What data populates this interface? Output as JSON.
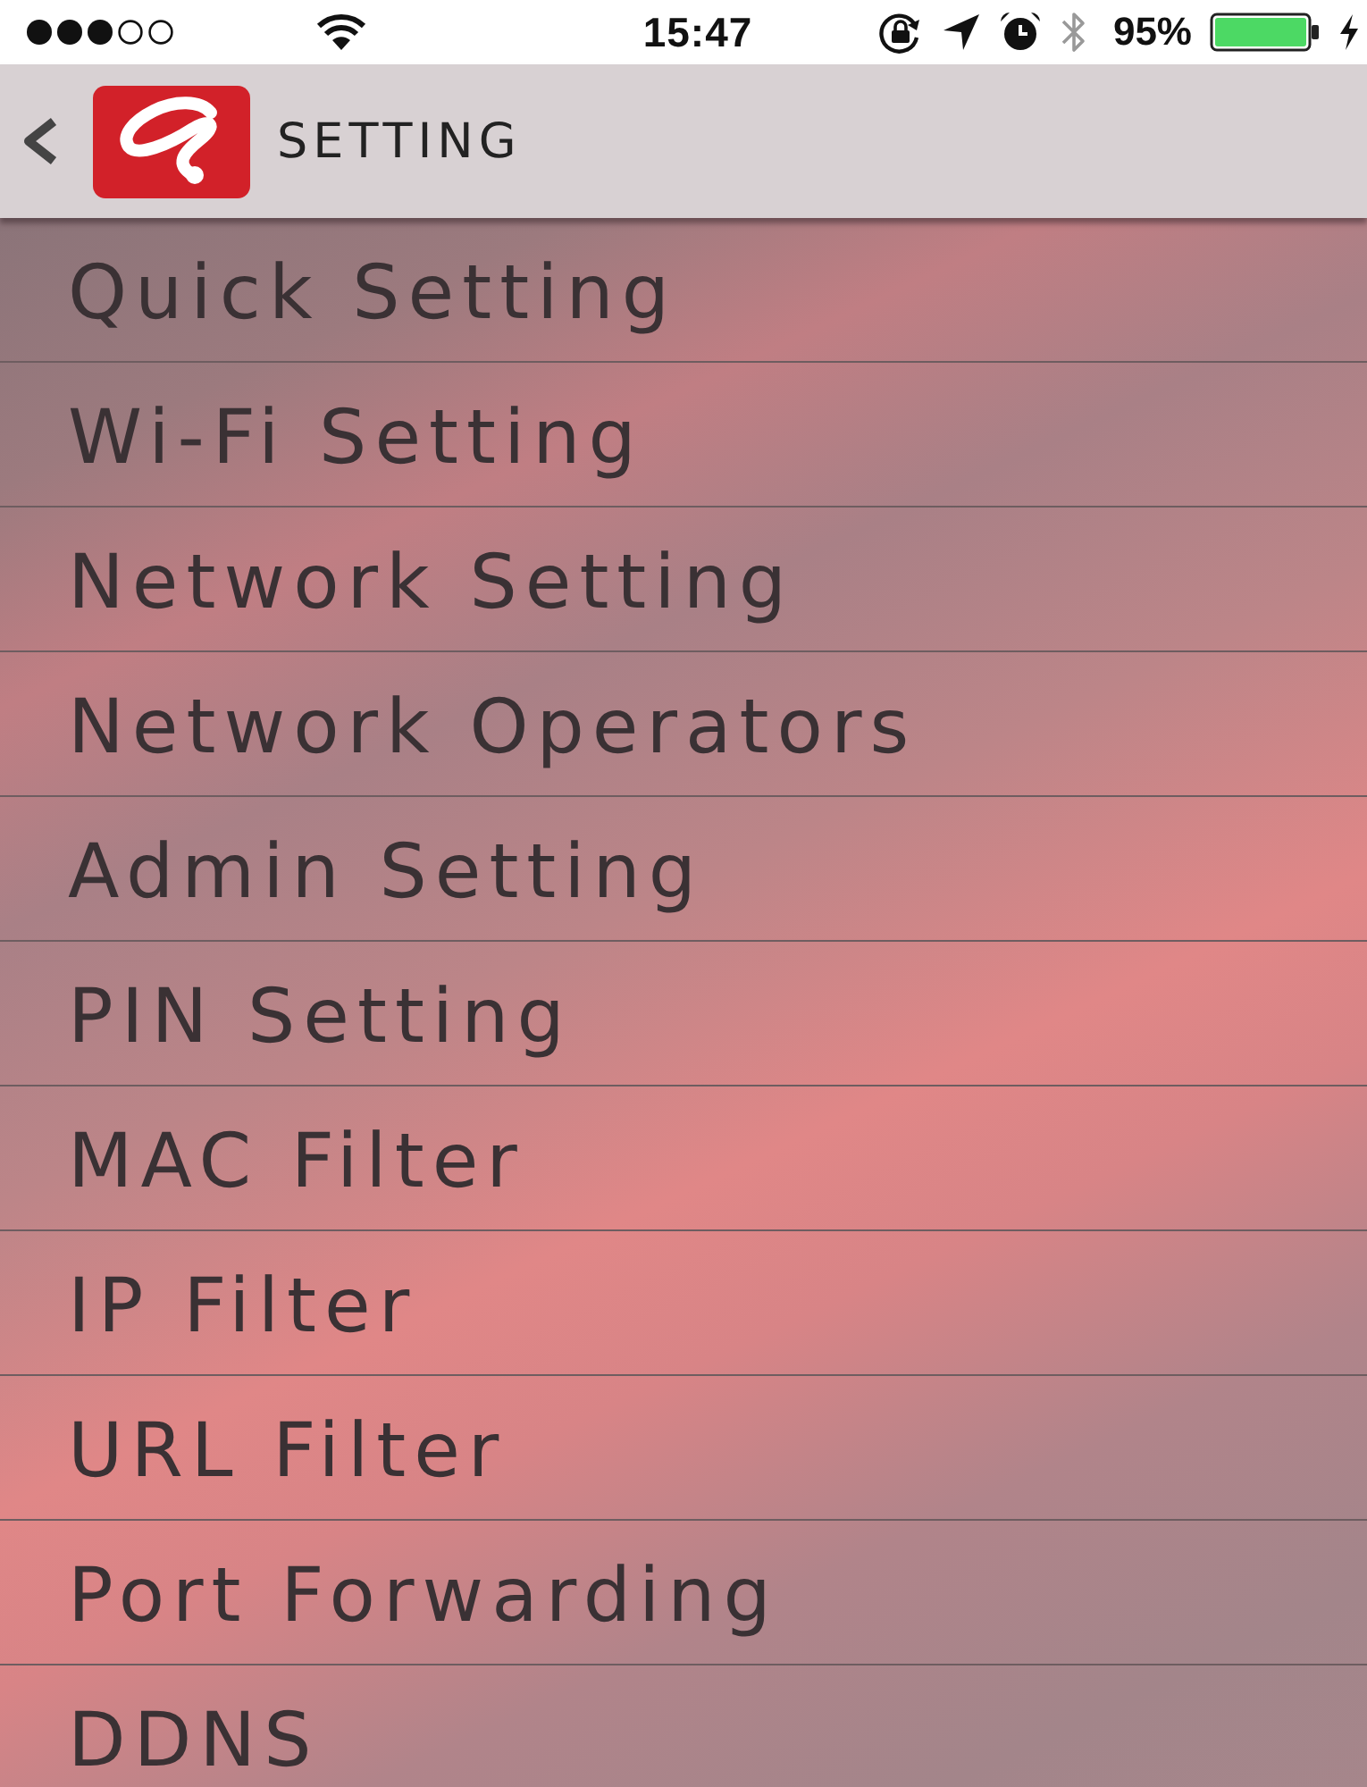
{
  "status_bar": {
    "time": "15:47",
    "battery": "95%"
  },
  "header": {
    "title": "SETTING"
  },
  "menu": {
    "items": [
      {
        "label": "Quick Setting"
      },
      {
        "label": "Wi-Fi Setting"
      },
      {
        "label": "Network Setting"
      },
      {
        "label": "Network Operators"
      },
      {
        "label": "Admin Setting"
      },
      {
        "label": "PIN Setting"
      },
      {
        "label": "MAC Filter"
      },
      {
        "label": "IP Filter"
      },
      {
        "label": "URL Filter"
      },
      {
        "label": "Port Forwarding"
      },
      {
        "label": "DDNS"
      }
    ]
  }
}
